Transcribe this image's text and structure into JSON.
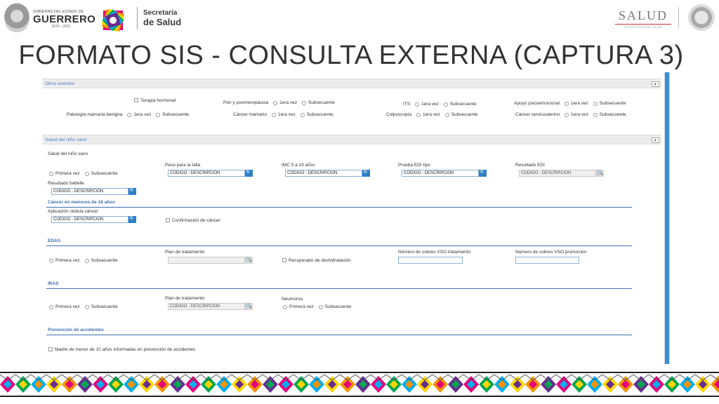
{
  "header": {
    "gov_small": "GOBIERNO DEL ESTADO DE",
    "gov_big": "GUERRERO",
    "gov_years": "2015 - 2021",
    "sec_line1": "Secretaría",
    "sec_line2": "de Salud",
    "salud_word": "SALUD",
    "salud_sub": "SECRETARÍA DE SALUD"
  },
  "title": "FORMATO SIS - CONSULTA EXTERNA (CAPTURA 3)",
  "otros_eventos": {
    "header": "Otros eventos",
    "collapse": "▲",
    "terapia": "Terapia hormonal",
    "peri": "Peri y posmenopausia",
    "peri_o1": "1era vez",
    "peri_o2": "Subsecuente",
    "its": "ITS",
    "its_o1": "1era vez",
    "its_o2": "Subsecuente",
    "apoyo": "Apoyo psicoemocional",
    "apoyo_o1": "1era vez",
    "apoyo_o2": "Subsecuente",
    "patologia": "Patología mamaria benigna",
    "pat_o1": "1era vez",
    "pat_o2": "Subsecuente",
    "cancer_mamario": "Cáncer mamario",
    "cm_o1": "1era vez",
    "cm_o2": "Subsecuente",
    "colposcopia": "Colposcopía",
    "col_o1": "1era vez",
    "col_o2": "Subsecuente",
    "cancer_cervico": "Cáncer cervicouterino",
    "cc_o1": "1era vez",
    "cc_o2": "Subsecuente"
  },
  "nino_sano": {
    "header": "Salud del niño sano",
    "collapse": "▲",
    "label": "Salud del niño sano",
    "o1": "Primera vez",
    "o2": "Subsecuente",
    "peso_label": "Peso para la talla",
    "peso_value": "CODIGO - DESCRIPCION",
    "imc_label": "IMC 5 a 19 años",
    "imc_value": "CODIGO - DESCRIPCION",
    "edi_label": "Prueba EDI tipo",
    "edi_value": "CODIGO - DESCRIPCION",
    "resedi_label": "Resultado EDI",
    "resedi_value": "CODIGO - DESCRIPCION",
    "battelle_label": "Resultado battelle",
    "battelle_value": "CODIGO - DESCRIPCION",
    "search_icon": "🔍"
  },
  "cancer_menores": {
    "title": "Cáncer en menores de 18 años",
    "cedula_label": "Aplicación cédula cáncer",
    "cedula_value": "CODIGO - DESCRIPCION",
    "confirmacion": "Confirmación de cáncer"
  },
  "edas": {
    "title": "EDAS",
    "o1": "Primera vez",
    "o2": "Subsecuente",
    "plan_label": "Plan de tratamiento",
    "plan_value": "",
    "recuperado": "Recuperado de deshidratación",
    "vso_trat_label": "Número de sobres VSO tratamiento",
    "vso_trat_value": "",
    "vso_prom_label": "Número de sobres VSO promoción",
    "vso_prom_value": ""
  },
  "iras": {
    "title": "IRAS",
    "o1": "Primera vez",
    "o2": "Subsecuente",
    "plan_label": "Plan de tratamiento",
    "plan_value": "CODIGO - DESCRIPCION",
    "neumonia_label": "Neumonía",
    "neu_o1": "Primera vez",
    "neu_o2": "Subsecuente"
  },
  "accidentes": {
    "title": "Prevención de accidentes",
    "madre": "Madre de menor de 10 años informadas en prevención de accidentes"
  },
  "colors": {
    "accent_blue": "#2a82d4",
    "section_blue": "#3f6fb0",
    "scrollbar": "#3b8fd8"
  }
}
